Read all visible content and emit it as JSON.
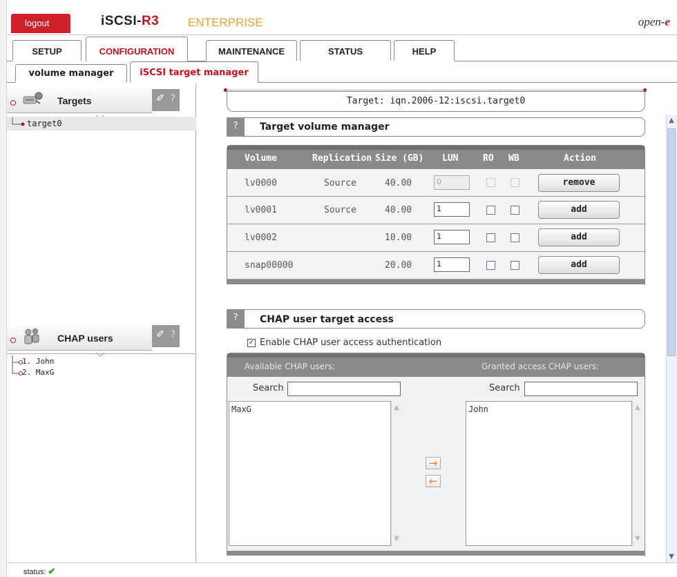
{
  "header": {
    "logout_label": "logout",
    "brand_main": "iSCSI-",
    "brand_r3": "R3",
    "brand_edition": "ENTERPRISE",
    "vendor_prefix": "open-",
    "vendor_e": "e"
  },
  "main_tabs": [
    {
      "label": "SETUP"
    },
    {
      "label": "CONFIGURATION"
    },
    {
      "label": "MAINTENANCE"
    },
    {
      "label": "STATUS"
    },
    {
      "label": "HELP"
    }
  ],
  "sub_tabs": [
    {
      "label": "volume manager"
    },
    {
      "label": "iSCSI target manager"
    }
  ],
  "left": {
    "targets_title": "Targets",
    "targets": [
      "target0"
    ],
    "chap_title": "CHAP users",
    "chap_users": [
      "1. John",
      "2. MaxG"
    ],
    "tool_help": "?"
  },
  "target_title": "Target: iqn.2006-12:iscsi.target0",
  "volume_section": {
    "help": "?",
    "title": "Target volume manager",
    "columns": [
      "Volume",
      "Replication",
      "Size (GB)",
      "LUN",
      "RO",
      "WB",
      "Action"
    ],
    "rows": [
      {
        "volume": "lv0000",
        "replication": "Source",
        "size": "40.00",
        "lun": "0",
        "lun_disabled": true,
        "action": "remove"
      },
      {
        "volume": "lv0001",
        "replication": "Source",
        "size": "40.00",
        "lun": "1",
        "lun_disabled": false,
        "action": "add"
      },
      {
        "volume": "lv0002",
        "replication": "",
        "size": "10.00",
        "lun": "1",
        "lun_disabled": false,
        "action": "add"
      },
      {
        "volume": "snap00000",
        "replication": "",
        "size": "20.00",
        "lun": "1",
        "lun_disabled": false,
        "action": "add"
      }
    ]
  },
  "chap_section": {
    "help": "?",
    "title": "CHAP user target access",
    "enable_label": "Enable CHAP user access authentication",
    "enable_checked": true,
    "available_label": "Available CHAP users:",
    "granted_label": "Granted access CHAP users:",
    "search_label": "Search",
    "available_users": [
      "MaxG"
    ],
    "granted_users": [
      "John"
    ]
  },
  "status": {
    "label": "status:",
    "icon": "check-icon"
  },
  "colors": {
    "accent_red": "#c8101a",
    "edition_orange": "#f0a030",
    "header_gray": "#8a8a8a"
  }
}
